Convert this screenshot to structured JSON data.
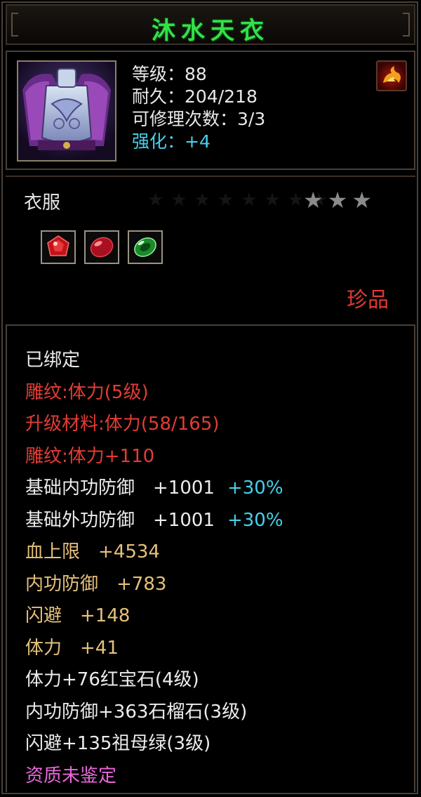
{
  "item": {
    "name": "沐水天衣",
    "stats": [
      {
        "key": "等级：",
        "value": "88"
      },
      {
        "key": "耐久：",
        "value": "204/218"
      },
      {
        "key": "可修理次数：",
        "value": "3/3"
      },
      {
        "key": "强化：",
        "value": "+4"
      }
    ],
    "category": "衣服",
    "star_rating": 3,
    "rarity": "珍品",
    "sockets": [
      "ruby-gem-icon",
      "garnet-gem-icon",
      "emerald-gem-icon"
    ]
  },
  "attributes": [
    {
      "text": "已绑定",
      "pct": "",
      "color": "#ececec"
    },
    {
      "text": "雕纹:体力(5级)",
      "pct": "",
      "color": "#e43c34"
    },
    {
      "text": "升级材料:体力(58/165)",
      "pct": "",
      "color": "#e43c34"
    },
    {
      "text": "雕纹:体力+110",
      "pct": "",
      "color": "#e43c34"
    },
    {
      "text": "基础内功防御　+1001",
      "pct": "+30%",
      "color": "#ececec"
    },
    {
      "text": "基础外功防御　+1001",
      "pct": "+30%",
      "color": "#ececec"
    },
    {
      "text": "血上限　+4534",
      "pct": "",
      "color": "#e6c17a"
    },
    {
      "text": "内功防御　+783",
      "pct": "",
      "color": "#e6c17a"
    },
    {
      "text": "闪避　+148",
      "pct": "",
      "color": "#e6c17a"
    },
    {
      "text": "体力　+41",
      "pct": "",
      "color": "#e6c17a"
    },
    {
      "text": "体力+76红宝石(4级)",
      "pct": "",
      "color": "#ececec"
    },
    {
      "text": "内功防御+363石榴石(3级)",
      "pct": "",
      "color": "#ececec"
    },
    {
      "text": "闪避+135祖母绿(3级)",
      "pct": "",
      "color": "#ececec"
    },
    {
      "text": "资质未鉴定",
      "pct": "",
      "color": "#e868d8"
    }
  ]
}
